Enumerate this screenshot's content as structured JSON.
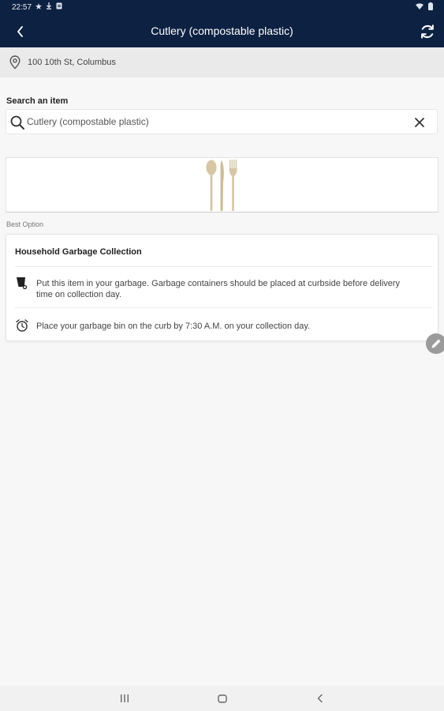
{
  "status_bar": {
    "time": "22:57"
  },
  "app_bar": {
    "title": "Cutlery (compostable plastic)",
    "back_icon": "chevron-left-icon",
    "refresh_icon": "refresh-icon"
  },
  "location": {
    "address": "100 10th St, Columbus",
    "icon": "location-pin-icon"
  },
  "search": {
    "label": "Search an item",
    "value": "Cutlery (compostable plastic)",
    "icon": "search-icon",
    "clear_icon": "close-icon"
  },
  "item_image": {
    "icon": "cutlery-icon"
  },
  "results": {
    "section_label": "Best Option",
    "card": {
      "title": "Household Garbage Collection",
      "instructions": [
        {
          "icon": "garbage-bin-icon",
          "text": "Put this item in your garbage. Garbage containers should be placed at curbside before delivery time on collection day."
        },
        {
          "icon": "alarm-clock-icon",
          "text": "Place your garbage bin on the curb by 7:30 A.M. on your collection day."
        }
      ]
    }
  },
  "fab": {
    "icon": "pencil-icon"
  },
  "colors": {
    "header_bg": "#0d2142",
    "location_bg": "#eaeaea",
    "page_bg": "#f7f7f7",
    "cutlery": "#d6c6a3"
  }
}
